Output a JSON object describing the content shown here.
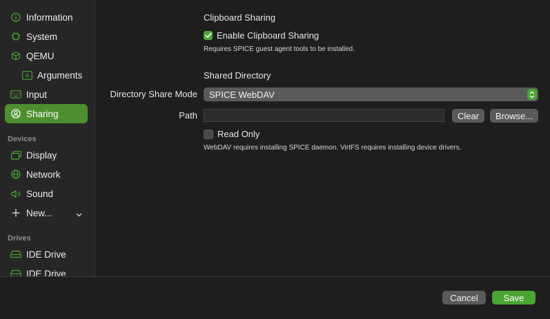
{
  "sidebar": {
    "items": [
      {
        "label": "Information",
        "icon": "info-icon"
      },
      {
        "label": "System",
        "icon": "chip-icon"
      },
      {
        "label": "QEMU",
        "icon": "cube-icon"
      },
      {
        "label": "Arguments",
        "icon": "arguments-icon"
      },
      {
        "label": "Input",
        "icon": "keyboard-icon"
      },
      {
        "label": "Sharing",
        "icon": "person-circle-icon",
        "selected": true
      }
    ],
    "devices_header": "Devices",
    "devices": [
      {
        "label": "Display",
        "icon": "display-icon"
      },
      {
        "label": "Network",
        "icon": "globe-icon"
      },
      {
        "label": "Sound",
        "icon": "speaker-icon"
      },
      {
        "label": "New...",
        "icon": "plus-icon"
      }
    ],
    "drives_header": "Drives",
    "drives": [
      {
        "label": "IDE Drive",
        "icon": "drive-icon"
      },
      {
        "label": "IDE Drive",
        "icon": "drive-icon"
      }
    ]
  },
  "clipboard": {
    "title": "Clipboard Sharing",
    "checkbox_label": "Enable Clipboard Sharing",
    "checked": true,
    "note": "Requires SPICE guest agent tools to be installed."
  },
  "shared_directory": {
    "title": "Shared Directory",
    "mode_label": "Directory Share Mode",
    "mode_value": "SPICE WebDAV",
    "path_label": "Path",
    "path_value": "",
    "clear_label": "Clear",
    "browse_label": "Browse...",
    "readonly_label": "Read Only",
    "readonly_checked": false,
    "note": "WebDAV requires installing SPICE daemon. VirtFS requires installing device drivers."
  },
  "footer": {
    "cancel_label": "Cancel",
    "save_label": "Save"
  },
  "colors": {
    "accent": "#4aa533",
    "selected_bg": "#4d8f2e",
    "background": "#1e1e1e",
    "sidebar_bg": "#262626"
  }
}
